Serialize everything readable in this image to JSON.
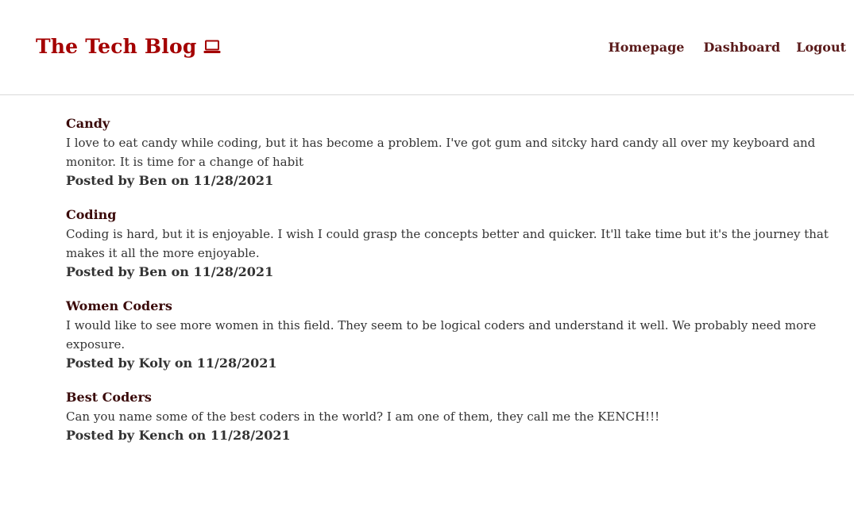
{
  "header": {
    "brand": "The Tech Blog",
    "brand_icon": "laptop-icon",
    "brand_color": "#a40000",
    "nav": {
      "homepage": "Homepage",
      "dashboard": "Dashboard",
      "logout": "Logout"
    }
  },
  "posts": [
    {
      "title": "Candy",
      "body": "I love to eat candy while coding, but it has become a problem. I've got gum and sitcky hard candy all over my keyboard and monitor. It is time for a change of habit",
      "meta": "Posted by Ben on 11/28/2021"
    },
    {
      "title": "Coding",
      "body": "Coding is hard, but it is enjoyable. I wish I could grasp the concepts better and quicker. It'll take time but it's the journey that makes it all the more enjoyable.",
      "meta": "Posted by Ben on 11/28/2021"
    },
    {
      "title": "Women Coders",
      "body": "I would like to see more women in this field. They seem to be logical coders and understand it well. We probably need more exposure.",
      "meta": "Posted by Koly on 11/28/2021"
    },
    {
      "title": "Best Coders",
      "body": "Can you name some of the best coders in the world? I am one of them, they call me the KENCH!!!",
      "meta": "Posted by Kench on 11/28/2021"
    }
  ]
}
